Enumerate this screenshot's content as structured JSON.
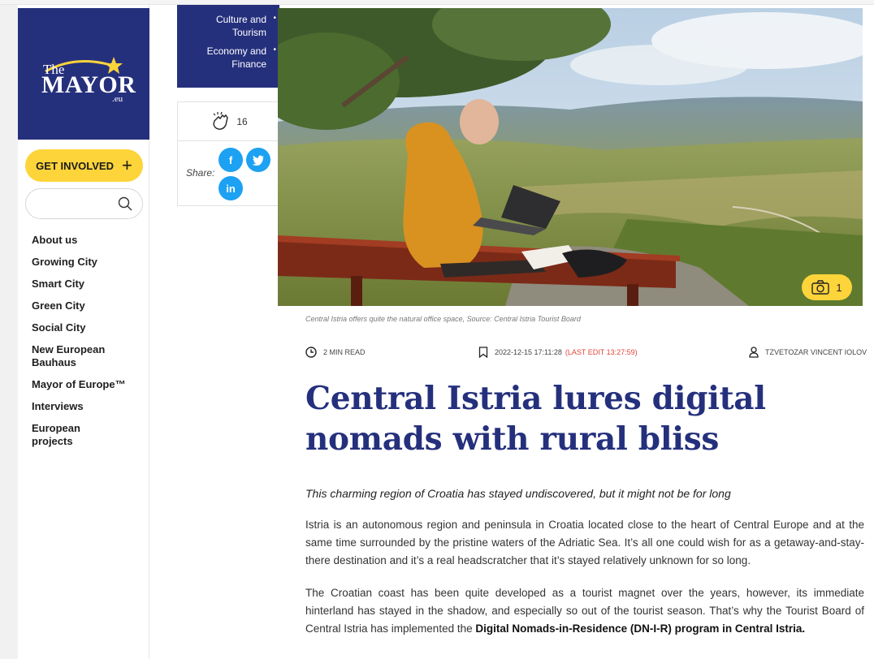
{
  "brand": {
    "the": "The",
    "name": "MAYOR",
    "tld": ".eu"
  },
  "sidebar": {
    "cta_label": "GET INVOLVED",
    "search_placeholder": "",
    "items": [
      {
        "label": "About us"
      },
      {
        "label": "Growing City"
      },
      {
        "label": "Smart City"
      },
      {
        "label": "Green City"
      },
      {
        "label": "Social City"
      },
      {
        "label": "New European Bauhaus"
      },
      {
        "label": "Mayor of Europe™"
      },
      {
        "label": "Interviews"
      },
      {
        "label": "European projects"
      }
    ]
  },
  "categories": [
    {
      "label": "Culture and Tourism"
    },
    {
      "label": "Economy and Finance"
    }
  ],
  "engagement": {
    "claps": "16",
    "share_label": "Share:",
    "networks": [
      {
        "icon": "facebook-icon",
        "glyph": "f"
      },
      {
        "icon": "twitter-icon",
        "glyph": ""
      },
      {
        "icon": "linkedin-icon",
        "glyph": "in"
      }
    ]
  },
  "hero": {
    "photo_count": "1",
    "caption": "Central Istria offers quite the natural office space, Source: Central Istria Tourist Board"
  },
  "article": {
    "read_time": "2 MIN READ",
    "date": "2022-12-15 17:11:28",
    "last_edit": "(LAST EDIT 13:27:59)",
    "author": "TZVETOZAR VINCENT IOLOV",
    "title": "Central Istria lures digital nomads with rural bliss",
    "lead": "This charming region of Croatia has stayed undiscovered, but it might not be for long",
    "paragraph1": "Istria is an autonomous region and peninsula in Croatia located close to the heart of Central Europe and at the same time surrounded by the pristine waters of the Adriatic Sea. It’s all one could wish for as a getaway-and-stay-there destination and it’s a real headscratcher that it’s stayed relatively unknown for so long.",
    "paragraph2_text": "The Croatian coast has been quite developed as a tourist magnet over the years, however, its immediate hinterland has stayed in the shadow, and especially so out of the tourist season. That’s why the Tourist Board of Central Istria has implemented the ",
    "paragraph2_bold": "Digital Nomads-in-Residence (DN-I-R) program in Central Istria."
  },
  "colors": {
    "brand_navy": "#25307d",
    "accent_yellow": "#fdd43a",
    "social_blue": "#1da1f2",
    "edit_red": "#e0463a"
  }
}
